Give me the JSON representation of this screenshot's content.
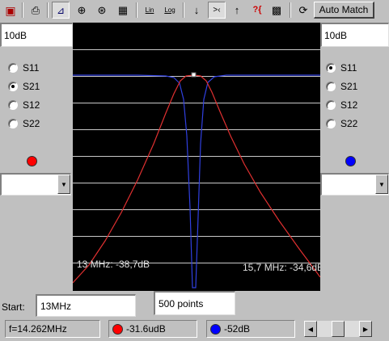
{
  "toolbar": {
    "buttons": [
      {
        "name": "save-icon",
        "glyph": "💾"
      },
      {
        "name": "print-icon",
        "glyph": "🖶"
      },
      {
        "name": "graph-view-icon",
        "glyph": "📈"
      },
      {
        "name": "smith-chart-icon",
        "glyph": "⊕"
      },
      {
        "name": "polar-chart-icon",
        "glyph": "⊛"
      },
      {
        "name": "table-view-icon",
        "glyph": "▦"
      },
      {
        "name": "linear-scale-icon",
        "glyph": "Lin"
      },
      {
        "name": "log-scale-icon",
        "glyph": "Log"
      },
      {
        "name": "arrow-down-icon",
        "glyph": "↓"
      },
      {
        "name": "zoom-in-icon",
        "glyph": ">‹"
      },
      {
        "name": "arrow-up-icon",
        "glyph": "↑"
      },
      {
        "name": "help-icon",
        "glyph": "?{}"
      },
      {
        "name": "calibration-icon",
        "glyph": "▩"
      },
      {
        "name": "refresh-icon",
        "glyph": "⟳"
      }
    ],
    "auto_match_label": "Auto Match"
  },
  "left_panel": {
    "scale_value": "10dB",
    "params": [
      "S11",
      "S21",
      "S12",
      "S22"
    ],
    "selected_param": "S21",
    "marker_color": "#ff0000",
    "combo_value": ""
  },
  "right_panel": {
    "scale_value": "10dB",
    "params": [
      "S11",
      "S21",
      "S12",
      "S22"
    ],
    "selected_param": "S11",
    "marker_color": "#0000ff",
    "combo_value": ""
  },
  "graph": {
    "background": "#000000",
    "grid_color": "#c8c8c8",
    "red_trace_color": "#e03030",
    "blue_trace_color": "#3040e0",
    "label_left": "13 MHz: -38,7dB",
    "label_right": "15,7 MHz: -34,6dB"
  },
  "bottom": {
    "start_label": "Start:",
    "start_value": "13MHz",
    "points_value": "500 points"
  },
  "status": {
    "frequency": "f=14.262MHz",
    "red_reading": "-31.6udB",
    "blue_reading": "-52dB"
  },
  "scrollbar": {
    "position": 0.5
  }
}
